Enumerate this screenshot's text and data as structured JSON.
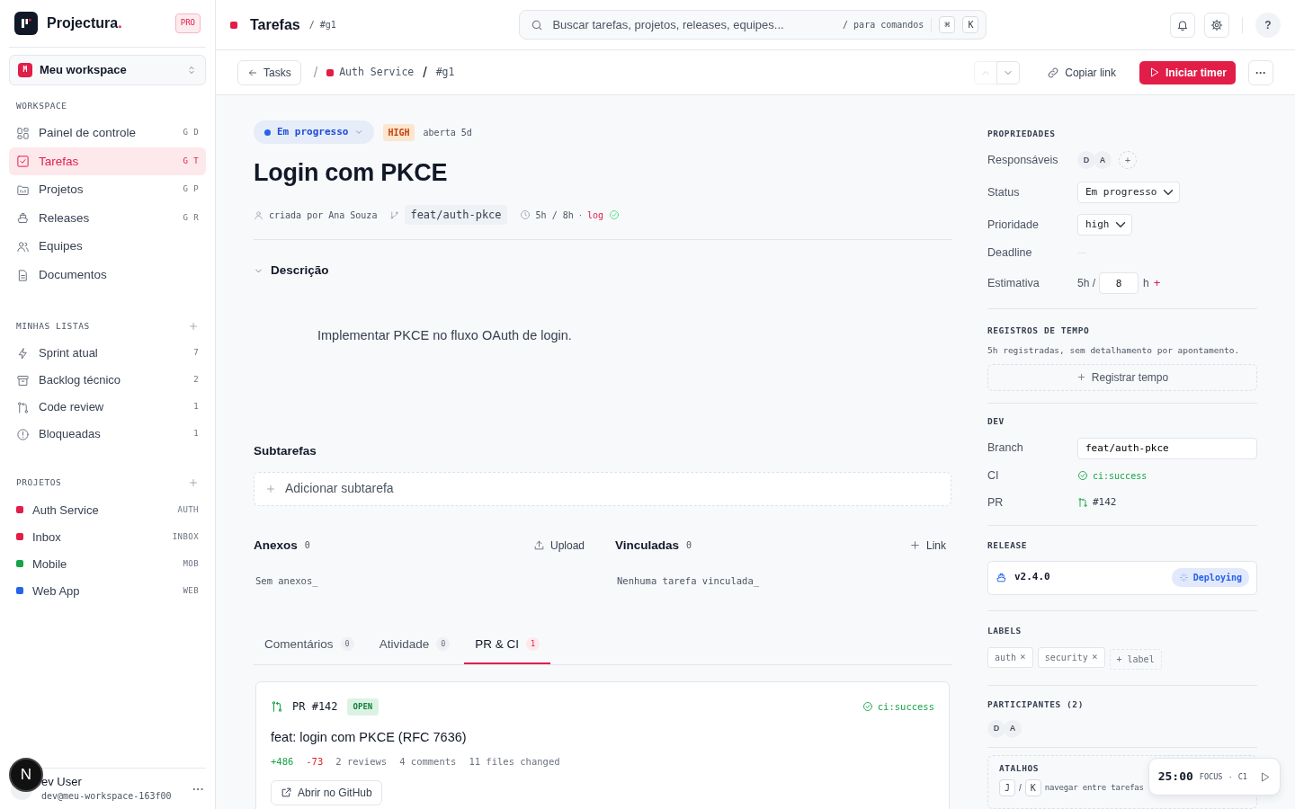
{
  "app": {
    "name": "Projectura",
    "name_mark": ".",
    "plan": "PRO"
  },
  "workspace": {
    "initial": "M",
    "name": "Meu workspace"
  },
  "nav_sections": [
    {
      "title": "WORKSPACE",
      "addable": false,
      "items": [
        {
          "kind": "nav",
          "label": "Painel de controle",
          "shortcut": "G D",
          "selected": false
        },
        {
          "kind": "nav",
          "label": "Tarefas",
          "shortcut": "G T",
          "selected": true
        },
        {
          "kind": "nav",
          "label": "Projetos",
          "shortcut": "G P",
          "selected": false
        },
        {
          "kind": "nav",
          "label": "Releases",
          "shortcut": "G R",
          "selected": false
        },
        {
          "kind": "nav",
          "label": "Equipes",
          "selected": false
        },
        {
          "kind": "nav",
          "label": "Documentos",
          "selected": false
        }
      ]
    },
    {
      "title": "MINHAS LISTAS",
      "addable": true,
      "items": [
        {
          "kind": "list",
          "label": "Sprint atual",
          "count": "7",
          "selected": false
        },
        {
          "kind": "list",
          "label": "Backlog técnico",
          "count": "2",
          "selected": false
        },
        {
          "kind": "list",
          "label": "Code review",
          "count": "1",
          "selected": false
        },
        {
          "kind": "list",
          "label": "Bloqueadas",
          "count": "1",
          "selected": false
        }
      ]
    },
    {
      "title": "PROJETOS",
      "addable": true,
      "items": [
        {
          "kind": "project",
          "label": "Auth Service",
          "code": "AUTH",
          "color": "#e11d48",
          "selected": false
        },
        {
          "kind": "project",
          "label": "Inbox",
          "code": "INBOX",
          "color": "#e11d48",
          "selected": false
        },
        {
          "kind": "project",
          "label": "Mobile",
          "code": "MOB",
          "color": "#16a34a",
          "selected": false
        },
        {
          "kind": "project",
          "label": "Web App",
          "code": "WEB",
          "color": "#2563eb",
          "selected": false
        }
      ]
    }
  ],
  "user": {
    "name": "ev User",
    "email": "dev@meu-workspace-163f00",
    "menu": "···",
    "dev_badge": "N"
  },
  "header": {
    "title": "Tarefas",
    "ref": "/ #g1",
    "search": {
      "placeholder": "Buscar tarefas, projetos, releases, equipes...",
      "hint": "/ para comandos",
      "keys": [
        "⌘",
        "K"
      ]
    },
    "help": "?"
  },
  "toolbar": {
    "back": "Tasks",
    "project": "Auth Service",
    "separator": "/",
    "task_ref": "#g1",
    "nav_arrows": [
      {
        "kind": "up",
        "disabled": true
      },
      {
        "kind": "down",
        "disabled": false
      }
    ],
    "copy_link": "Copiar link",
    "start_timer": "Iniciar timer",
    "more": "···"
  },
  "task": {
    "status": "Em progresso",
    "priority": "HIGH",
    "age": "aberta 5d",
    "title": "Login com PKCE",
    "meta": {
      "author": "criada por Ana Souza",
      "branch": "feat/auth-pkce",
      "time": "5h / 8h",
      "dot": "·",
      "log": "log"
    },
    "description": {
      "heading": "Descrição",
      "expanded": true,
      "text": "Implementar PKCE no fluxo OAuth de login."
    },
    "subtasks": {
      "title": "Subtarefas",
      "add": "Adicionar subtarefa"
    },
    "attachments": {
      "title": "Anexos",
      "count": "0",
      "action": "Upload",
      "empty": "Sem anexos_"
    },
    "linked": {
      "title": "Vinculadas",
      "count": "0",
      "action": "Link",
      "empty": "Nenhuma tarefa vinculada_"
    }
  },
  "tabs": [
    {
      "label": "Comentários",
      "count": "0",
      "selected": false
    },
    {
      "label": "Atividade",
      "count": "0",
      "selected": false
    },
    {
      "label": "PR & CI",
      "count": "1",
      "selected": true
    }
  ],
  "pull_request": {
    "number": "PR #142",
    "state": "OPEN",
    "ci": "ci:success",
    "title": "feat: login com PKCE (RFC 7636)",
    "additions": "+486",
    "deletions": "-73",
    "stats": [
      "2 reviews",
      "4 comments",
      "11 files changed"
    ],
    "open": "Abrir no GitHub"
  },
  "properties": {
    "heading": "PROPRIEDADES",
    "assignees_label": "Responsáveis",
    "assignees": [
      "D",
      "A"
    ],
    "add": "+",
    "status_label": "Status",
    "status": "Em progresso",
    "priority_label": "Prioridade",
    "priority": "high",
    "deadline_label": "Deadline",
    "estimate_label": "Estimativa",
    "estimate_spent": "5h /",
    "estimate": "8",
    "estimate_unit": "h",
    "estimate_add": "+"
  },
  "time_log": {
    "heading": "REGISTROS DE TEMPO",
    "text": "5h registradas, sem detalhamento por apontamento.",
    "button": "Registrar tempo"
  },
  "dev": {
    "heading": "DEV",
    "branch_label": "Branch",
    "branch": "feat/auth-pkce",
    "ci_label": "CI",
    "ci": "ci:success",
    "pr_label": "PR",
    "pr": "#142"
  },
  "release": {
    "heading": "RELEASE",
    "version": "v2.4.0",
    "status": "Deploying"
  },
  "labels": {
    "heading": "LABELS",
    "items": [
      "auth",
      "security"
    ],
    "remove": "×",
    "add": "+ label"
  },
  "participants": {
    "heading": "PARTICIPANTES (2)",
    "avatars": [
      "D",
      "A"
    ]
  },
  "shortcuts": {
    "heading": "ATALHOS",
    "keys": [
      "J",
      "K"
    ],
    "separator": "/",
    "text": "navegar entre tarefas"
  },
  "timer": {
    "time": "25:00",
    "mode": "FOCUS",
    "dot": "·",
    "cycle": "C1"
  }
}
